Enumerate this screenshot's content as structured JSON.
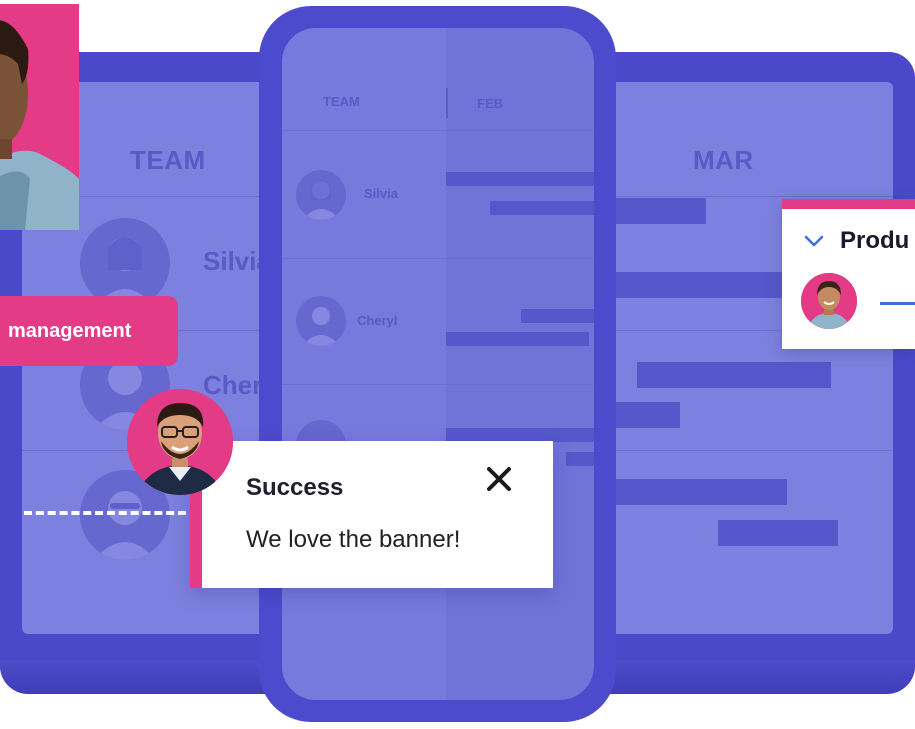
{
  "laptop": {
    "team_header": "TEAM",
    "mar_header": "MAR",
    "rows": [
      {
        "name": "Silvia"
      },
      {
        "name": "Cheryl"
      },
      {
        "name": ""
      }
    ]
  },
  "phone": {
    "team_header": "TEAM",
    "feb_header": "FEB",
    "rows": [
      {
        "name": "Silvia"
      },
      {
        "name": "Cheryl"
      }
    ]
  },
  "tag": {
    "label": "management"
  },
  "toast": {
    "title": "Success",
    "message": "We love the banner!",
    "close_icon": "close-icon"
  },
  "product_card": {
    "title": "Produ",
    "chevron_icon": "chevron-down-icon"
  },
  "colors": {
    "accent_pink": "#e43b86",
    "indigo": "#4b49c9",
    "indigo_light": "#7e80df",
    "link_blue": "#3f6fd8"
  }
}
